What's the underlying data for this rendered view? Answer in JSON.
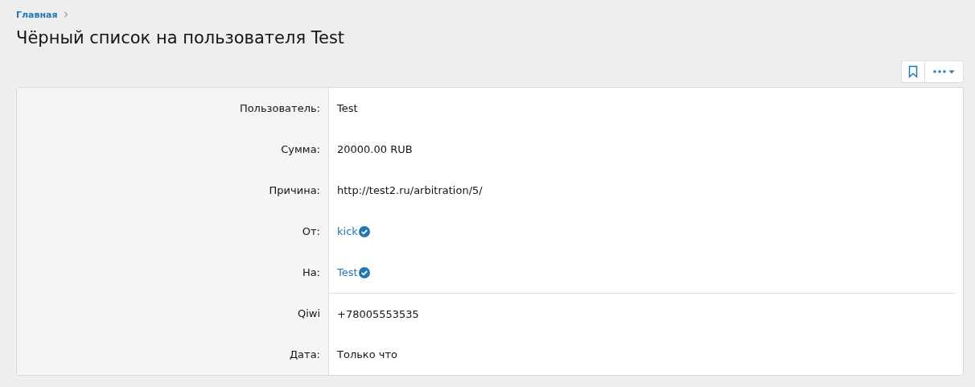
{
  "breadcrumb": [
    {
      "label": "Главная"
    }
  ],
  "title": "Чёрный список на пользователя Test",
  "sections": [
    {
      "rows": [
        {
          "label": "Пользователь:",
          "value": "Test",
          "kind": "text"
        },
        {
          "label": "Сумма:",
          "value": "20000.00 RUB",
          "kind": "text"
        },
        {
          "label": "Причина:",
          "value": "http://test2.ru/arbitration/5/",
          "kind": "text"
        },
        {
          "label": "От:",
          "value": "kick",
          "kind": "user"
        },
        {
          "label": "На:",
          "value": "Test",
          "kind": "user"
        }
      ]
    },
    {
      "rows": [
        {
          "label": "Qiwi",
          "value": "+78005553535",
          "kind": "text"
        },
        {
          "label": "Дата:",
          "value": "Только что",
          "kind": "text"
        }
      ]
    }
  ]
}
